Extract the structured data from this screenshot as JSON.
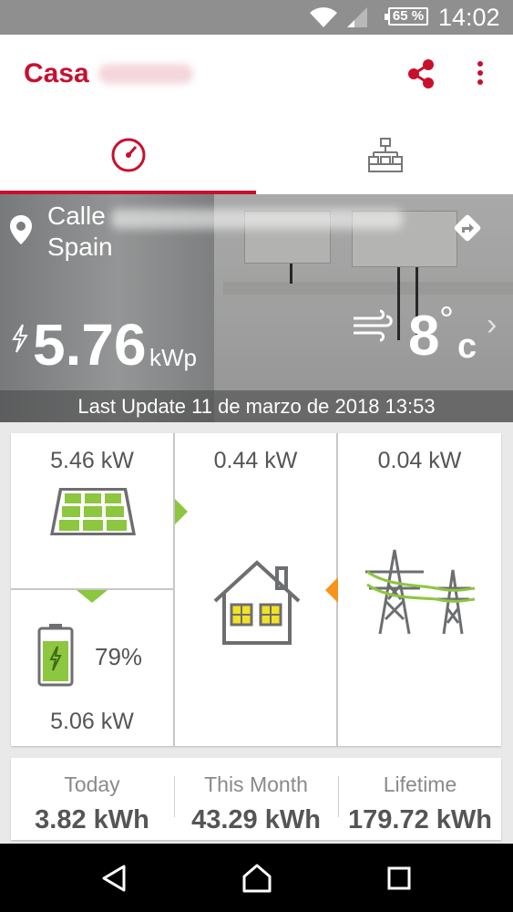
{
  "status_bar": {
    "battery_percent": "65 %",
    "time": "14:02"
  },
  "app_bar": {
    "title": "Casa",
    "icons": [
      "share-icon",
      "more-vert-icon"
    ],
    "accent_color": "#c8102e"
  },
  "tabs": [
    {
      "icon": "dashboard-gauge-icon",
      "selected": true
    },
    {
      "icon": "site-layout-icon",
      "selected": false
    }
  ],
  "hero": {
    "address_line1": "Calle",
    "address_line2": "Spain",
    "peak_power_value": "5.76",
    "peak_power_unit": "kWp",
    "temperature_value": "8",
    "temperature_degree": "°",
    "temperature_unit": "c",
    "last_update": "Last Update 11 de marzo de 2018 13:53"
  },
  "power_flow": {
    "pv_power": "5.46 kW",
    "home_consumption": "0.44 kW",
    "grid_power": "0.04 kW",
    "battery_percent": "79%",
    "battery_power": "5.06 kW",
    "colors": {
      "green": "#8dc63f",
      "orange": "#f7941d",
      "icon_gray": "#6d6e70"
    }
  },
  "energy_stats": [
    {
      "label": "Today",
      "value": "3.82 kWh"
    },
    {
      "label": "This Month",
      "value": "43.29 kWh"
    },
    {
      "label": "Lifetime",
      "value": "179.72 kWh"
    }
  ],
  "nav_bar": {
    "buttons": [
      "back-icon",
      "home-icon",
      "recents-icon"
    ]
  }
}
